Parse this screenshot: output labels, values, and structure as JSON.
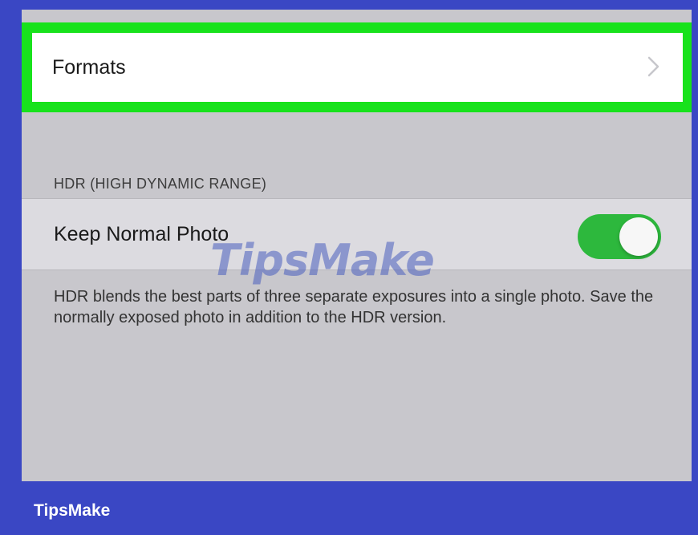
{
  "formats": {
    "label": "Formats"
  },
  "hdr_section": {
    "header": "HDR (HIGH DYNAMIC RANGE)",
    "keep_normal_photo": {
      "label": "Keep Normal Photo",
      "enabled": true
    },
    "description": "HDR blends the best parts of three separate exposures into a single photo. Save the normally exposed photo in addition to the HDR version."
  },
  "watermark_text": "TipsMake",
  "footer": {
    "brand": "TipsMake"
  },
  "colors": {
    "background": "#3a47c4",
    "highlight": "#18e21c",
    "toggle_on": "#2db83d",
    "settings_bg": "#c8c7cc"
  }
}
